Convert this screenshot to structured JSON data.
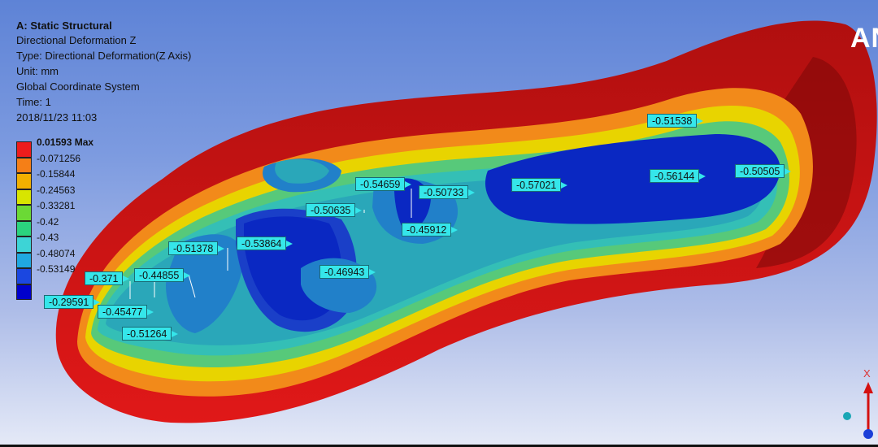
{
  "header": {
    "title": "A: Static Structural",
    "result": "Directional Deformation Z",
    "type": "Type: Directional Deformation(Z Axis)",
    "unit": "Unit: mm",
    "system": "Global Coordinate System",
    "time": "Time: 1",
    "date": "2018/11/23 11:03"
  },
  "logo": "AN",
  "legend": {
    "labels": [
      "0.01593 Max",
      "-0.071256",
      "-0.15844",
      "-0.24563",
      "-0.33281",
      "-0.42",
      "-0.43",
      "-0.48074",
      "-0.53149"
    ],
    "colors": [
      "#ee1c1c",
      "#f57f17",
      "#f2b000",
      "#d8e500",
      "#6bd935",
      "#2bd37e",
      "#3dd4d6",
      "#20a8e0",
      "#1b47e0",
      "#0000cc"
    ]
  },
  "probes": [
    {
      "text": "-0.51538",
      "name": "probe-051538"
    },
    {
      "text": "-0.56144",
      "name": "probe-056144"
    },
    {
      "text": "-0.50505",
      "name": "probe-050505"
    },
    {
      "text": "-0.57021",
      "name": "probe-057021"
    },
    {
      "text": "-0.54659",
      "name": "probe-054659"
    },
    {
      "text": "-0.50733",
      "name": "probe-050733"
    },
    {
      "text": "-0.50635",
      "name": "probe-050635"
    },
    {
      "text": "-0.45912",
      "name": "probe-045912"
    },
    {
      "text": "-0.51378",
      "name": "probe-051378"
    },
    {
      "text": "-0.53864",
      "name": "probe-053864"
    },
    {
      "text": "-0.46943",
      "name": "probe-046943"
    },
    {
      "text": "-0.371",
      "name": "probe-0371"
    },
    {
      "text": "-0.44855",
      "name": "probe-044855"
    },
    {
      "text": "-0.29591",
      "name": "probe-029591"
    },
    {
      "text": "-0.45477",
      "name": "probe-045477"
    },
    {
      "text": "-0.51264",
      "name": "probe-051264"
    }
  ],
  "triad": {
    "x_label": "X"
  }
}
